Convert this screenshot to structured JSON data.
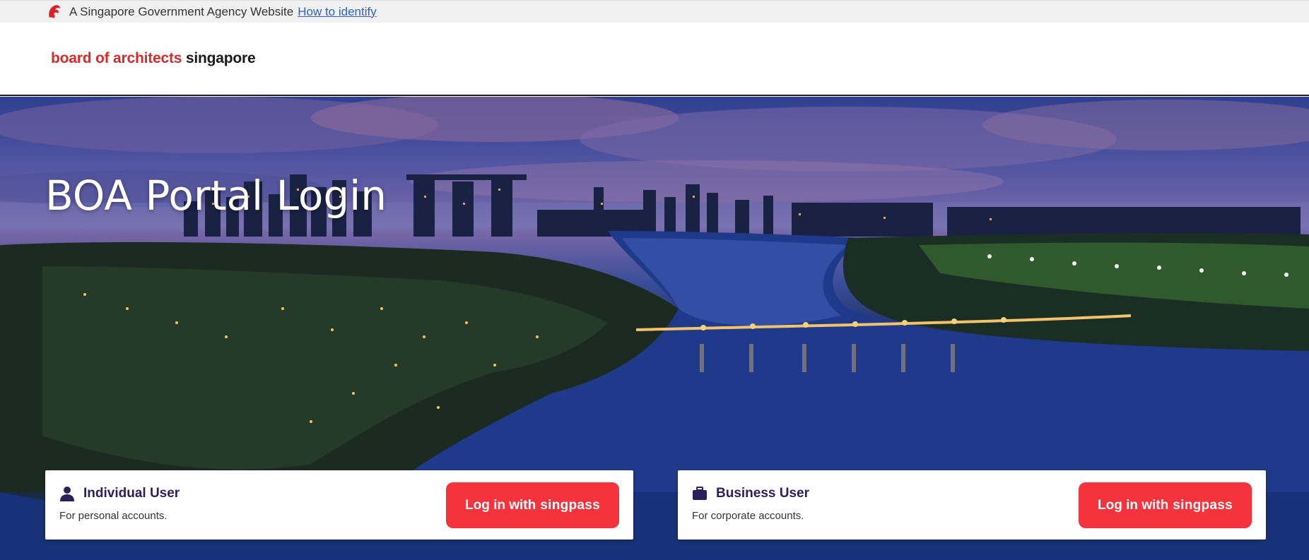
{
  "masthead": {
    "text": "A Singapore Government Agency Website",
    "link": "How to identify"
  },
  "header": {
    "logo_red": "board of architects",
    "logo_dark": "singapore"
  },
  "hero": {
    "title": "BOA Portal Login"
  },
  "cards": [
    {
      "title": "Individual User",
      "description": "For personal accounts.",
      "icon": "person-icon",
      "button_prefix": "Log in with",
      "button_brand": "singpass"
    },
    {
      "title": "Business User",
      "description": "For corporate accounts.",
      "icon": "briefcase-icon",
      "button_prefix": "Log in with",
      "button_brand": "singpass"
    }
  ],
  "colors": {
    "brand_red": "#d62b2b",
    "singpass_red": "#f4333d",
    "card_title": "#2b1f5c",
    "link_blue": "#2f5fc6"
  }
}
